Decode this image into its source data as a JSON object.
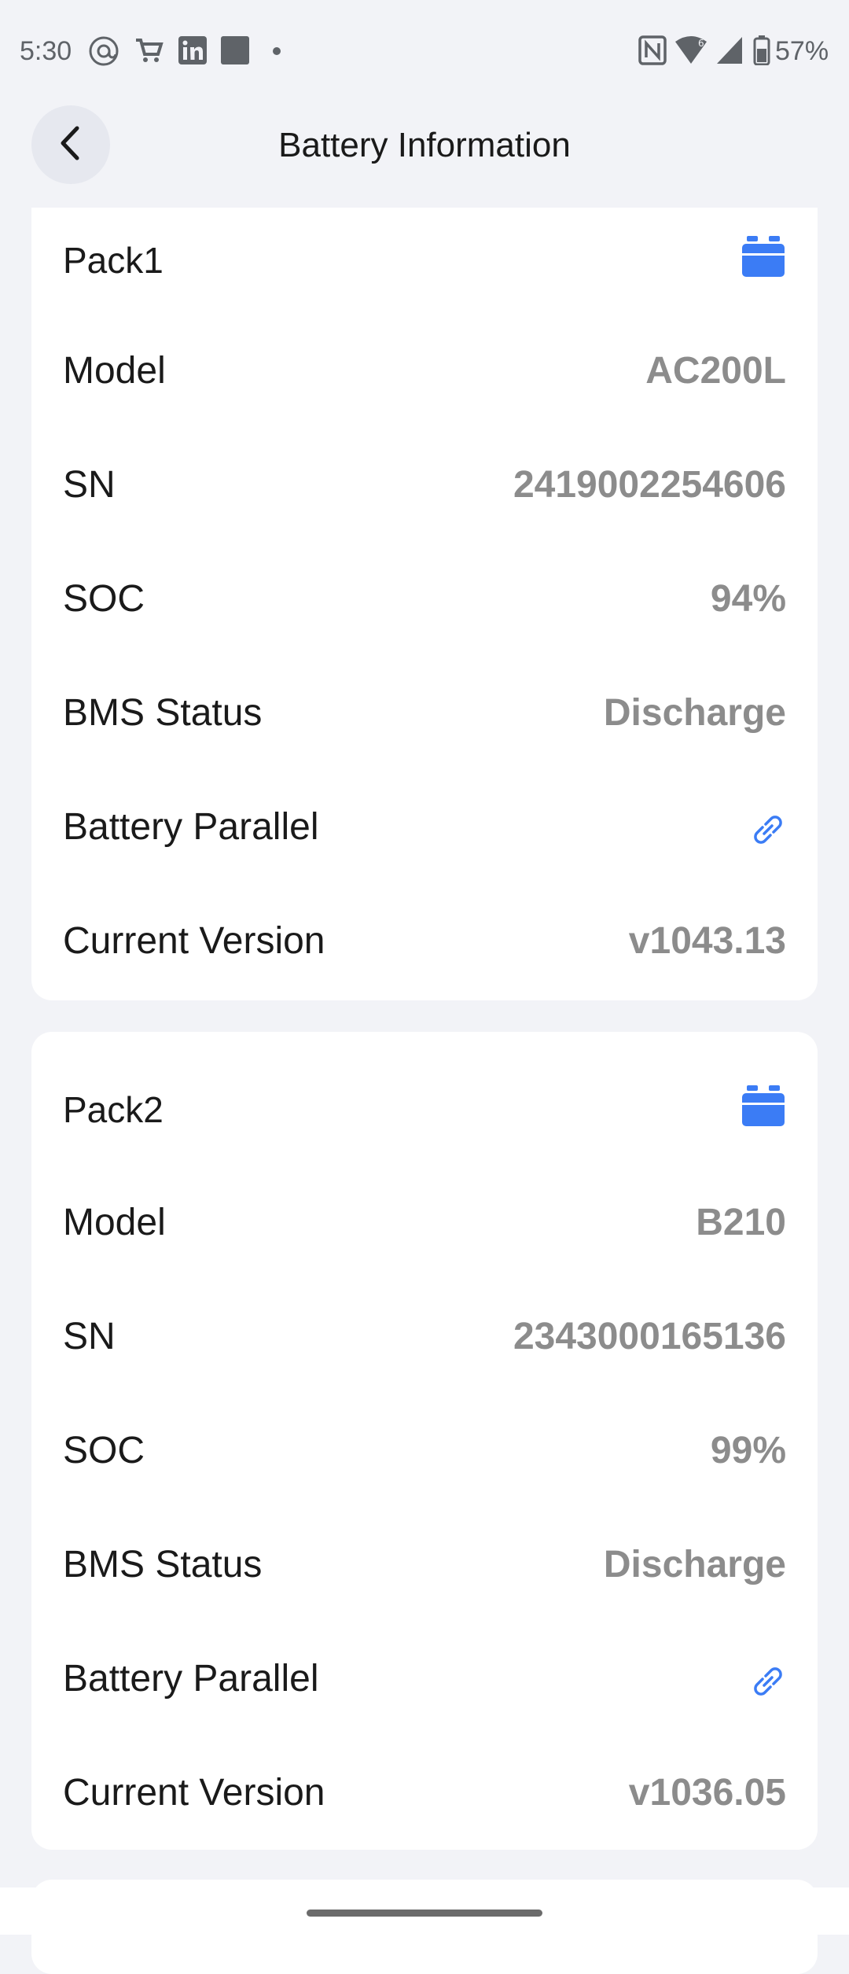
{
  "status_bar": {
    "time": "5:30",
    "battery_percent": "57%",
    "icons": [
      "at-sign-icon",
      "cart-icon",
      "linkedin-icon",
      "square-app-icon",
      "dot-icon",
      "nfc-icon",
      "wifi-icon",
      "signal-icon",
      "battery-icon"
    ]
  },
  "header": {
    "title": "Battery Information",
    "back_icon": "chevron-left-icon"
  },
  "colors": {
    "accent": "#3b7cf5",
    "value_gray": "#8c8c8c",
    "background": "#f2f3f7",
    "card": "#ffffff"
  },
  "packs": [
    {
      "title": "Pack1",
      "icon": "battery-pack-icon",
      "rows": [
        {
          "label": "Model",
          "value": "AC200L"
        },
        {
          "label": "SN",
          "value": "2419002254606"
        },
        {
          "label": "SOC",
          "value": "94%"
        },
        {
          "label": "BMS Status",
          "value": "Discharge"
        },
        {
          "label": "Battery Parallel",
          "icon": "link-icon"
        },
        {
          "label": "Current Version",
          "value": "v1043.13"
        }
      ]
    },
    {
      "title": "Pack2",
      "icon": "battery-pack-icon",
      "rows": [
        {
          "label": "Model",
          "value": "B210"
        },
        {
          "label": "SN",
          "value": "2343000165136"
        },
        {
          "label": "SOC",
          "value": "99%"
        },
        {
          "label": "BMS Status",
          "value": "Discharge"
        },
        {
          "label": "Battery Parallel",
          "icon": "link-icon"
        },
        {
          "label": "Current Version",
          "value": "v1036.05"
        }
      ]
    }
  ]
}
